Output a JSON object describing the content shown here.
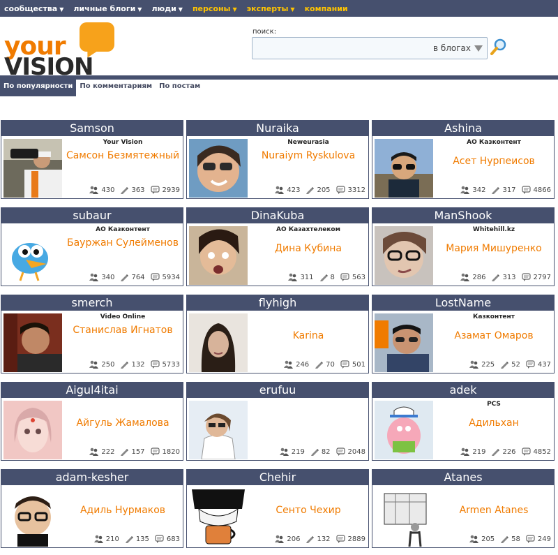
{
  "nav": [
    {
      "label": "сообщества",
      "arrow": "▼",
      "accent": false
    },
    {
      "label": "личные блоги",
      "arrow": "▼",
      "accent": false
    },
    {
      "label": "люди",
      "arrow": "▼",
      "accent": false
    },
    {
      "label": "персоны",
      "arrow": "▼",
      "accent": true
    },
    {
      "label": "эксперты",
      "arrow": "▼",
      "accent": true
    },
    {
      "label": "компании",
      "arrow": "",
      "accent": true
    }
  ],
  "logo": {
    "line1": "your",
    "line2": "VISION"
  },
  "search": {
    "label": "поиск:",
    "value": "",
    "placeholder": "",
    "scope": "в блогах"
  },
  "tabs": [
    {
      "label": "По популярности",
      "active": true
    },
    {
      "label": "По комментариям",
      "active": false
    },
    {
      "label": "По постам",
      "active": false
    }
  ],
  "colors": {
    "nav_bg": "#46506e",
    "accent": "#ffc400",
    "name": "#f07b00"
  },
  "bloggers": [
    {
      "nick": "Samson",
      "company": "Your Vision",
      "name": "Самсон Безмятежный",
      "friends": "430",
      "posts": "363",
      "comments": "2939"
    },
    {
      "nick": "Nuraika",
      "company": "Neweurasia",
      "name": "Nuraiym Ryskulova",
      "friends": "423",
      "posts": "205",
      "comments": "3312"
    },
    {
      "nick": "Ashina",
      "company": "АО Казконтент",
      "name": "Асет Нурпеисов",
      "friends": "342",
      "posts": "317",
      "comments": "4866"
    },
    {
      "nick": "subaur",
      "company": "АО Казконтент",
      "name": "Бауржан Сулейменов",
      "friends": "340",
      "posts": "764",
      "comments": "5934"
    },
    {
      "nick": "DinaKuba",
      "company": "АО Казахтелеком",
      "name": "Дина Кубина",
      "friends": "311",
      "posts": "8",
      "comments": "563"
    },
    {
      "nick": "ManShook",
      "company": "Whitehill.kz",
      "name": "Мария Мишуренко",
      "friends": "286",
      "posts": "313",
      "comments": "2797"
    },
    {
      "nick": "smerch",
      "company": "Video Online",
      "name": "Станислав Игнатов",
      "friends": "250",
      "posts": "132",
      "comments": "5733"
    },
    {
      "nick": "flyhigh",
      "company": "",
      "name": "Karina",
      "friends": "246",
      "posts": "70",
      "comments": "501"
    },
    {
      "nick": "LostName",
      "company": "Казконтент",
      "name": "Азамат Омаров",
      "friends": "225",
      "posts": "52",
      "comments": "437"
    },
    {
      "nick": "Aigul4itai",
      "company": "",
      "name": "Айгуль Жамалова",
      "friends": "222",
      "posts": "157",
      "comments": "1820"
    },
    {
      "nick": "erufuu",
      "company": "",
      "name": "",
      "friends": "219",
      "posts": "82",
      "comments": "2048"
    },
    {
      "nick": "adek",
      "company": "PCS",
      "name": "Адильхан",
      "friends": "219",
      "posts": "226",
      "comments": "4852"
    },
    {
      "nick": "adam-kesher",
      "company": "",
      "name": "Адиль Нурмаков",
      "friends": "210",
      "posts": "135",
      "comments": "683"
    },
    {
      "nick": "Chehir",
      "company": "",
      "name": "Сенто Чехир",
      "friends": "206",
      "posts": "132",
      "comments": "2889"
    },
    {
      "nick": "Atanes",
      "company": "",
      "name": "Armen Atanes",
      "friends": "205",
      "posts": "58",
      "comments": "249"
    }
  ],
  "icons": {
    "friends": "people-icon",
    "posts": "pencil-icon",
    "comments": "comment-icon",
    "search": "magnifier-icon"
  }
}
